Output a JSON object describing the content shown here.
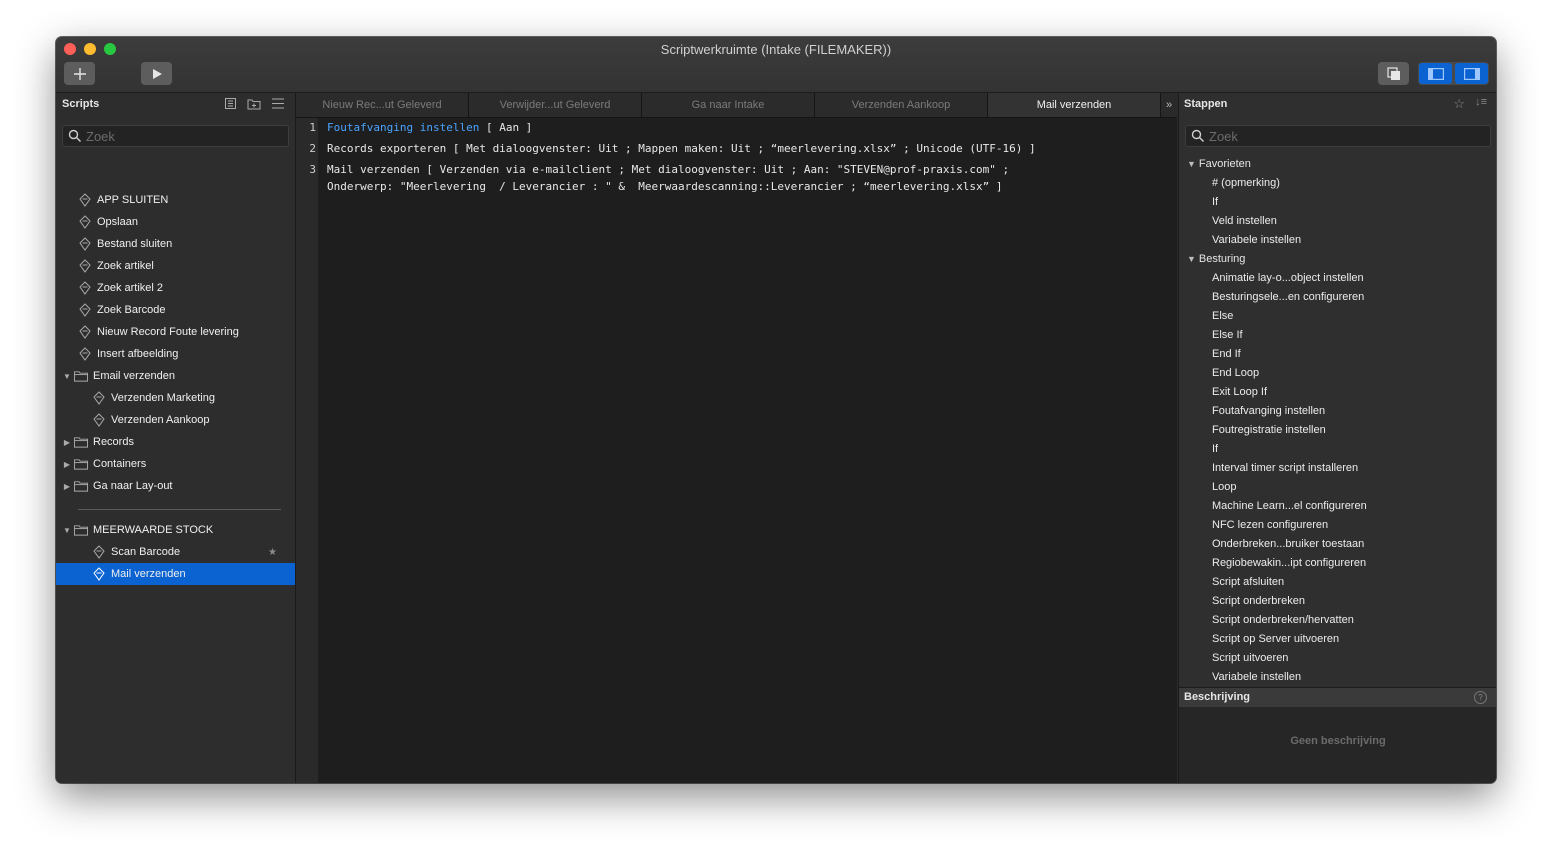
{
  "window": {
    "title": "Scriptwerkruimte (Intake (FILEMAKER))"
  },
  "scripts_panel": {
    "header": "Scripts",
    "search_placeholder": "Zoek",
    "items": [
      {
        "label": "APP SLUITEN",
        "kind": "script"
      },
      {
        "label": "Opslaan",
        "kind": "script"
      },
      {
        "label": "Bestand sluiten",
        "kind": "script"
      },
      {
        "label": "Zoek artikel",
        "kind": "script"
      },
      {
        "label": "Zoek artikel 2",
        "kind": "script"
      },
      {
        "label": "Zoek Barcode",
        "kind": "script"
      },
      {
        "label": "Nieuw Record Foute levering",
        "kind": "script"
      },
      {
        "label": "Insert afbeelding",
        "kind": "script"
      },
      {
        "label": "Email verzenden",
        "kind": "folder",
        "expanded": true
      },
      {
        "label": "Verzenden Marketing",
        "kind": "script",
        "indent": 1
      },
      {
        "label": "Verzenden Aankoop",
        "kind": "script",
        "indent": 1
      },
      {
        "label": "Records",
        "kind": "folder",
        "expanded": false
      },
      {
        "label": "Containers",
        "kind": "folder",
        "expanded": false
      },
      {
        "label": "Ga naar Lay-out",
        "kind": "folder",
        "expanded": false
      },
      {
        "label": "MEERWAARDE STOCK",
        "kind": "folder",
        "expanded": true
      },
      {
        "label": "Scan Barcode",
        "kind": "script",
        "indent": 1,
        "favorite": true
      },
      {
        "label": "Mail verzenden",
        "kind": "script",
        "indent": 1,
        "selected": true
      }
    ]
  },
  "editor": {
    "tabs": [
      {
        "label": "Nieuw Rec...ut Geleverd",
        "active": false
      },
      {
        "label": "Verwijder...ut Geleverd",
        "active": false
      },
      {
        "label": "Ga naar Intake",
        "active": false
      },
      {
        "label": "Verzenden Aankoop",
        "active": false
      },
      {
        "label": "Mail verzenden",
        "active": true
      }
    ],
    "more_tabs": "»",
    "lines": [
      {
        "num": "1",
        "keyword": "Foutafvanging instellen",
        "rest": " [ Aan ]"
      },
      {
        "num": "2",
        "keyword": "",
        "rest": "Records exporteren [ Met dialoogvenster: Uit ; Mappen maken: Uit ; “meerlevering.xlsx” ; Unicode (UTF-16) ]"
      },
      {
        "num": "3",
        "keyword": "",
        "rest": "Mail verzenden [ Verzenden via e-mailclient ; Met dialoogvenster: Uit ; Aan: \"STEVEN@prof-praxis.com\" ;"
      },
      {
        "num": "",
        "keyword": "",
        "rest": "Onderwerp: \"Meerlevering  / Leverancier : \" &  Meerwaardescanning::Leverancier ; “meerlevering.xlsx” ]"
      }
    ]
  },
  "steps_panel": {
    "header": "Stappen",
    "search_placeholder": "Zoek",
    "categories": [
      {
        "label": "Favorieten",
        "items": [
          "# (opmerking)",
          "If",
          "Veld instellen",
          "Variabele instellen"
        ]
      },
      {
        "label": "Besturing",
        "items": [
          "Animatie lay-o...object instellen",
          "Besturingsele...en configureren",
          "Else",
          "Else If",
          "End If",
          "End Loop",
          "Exit Loop If",
          "Foutafvanging instellen",
          "Foutregistratie instellen",
          "If",
          "Interval timer script installeren",
          "Loop",
          "Machine Learn...el configureren",
          "NFC lezen configureren",
          "Onderbreken...bruiker toestaan",
          "Regiobewakin...ipt configureren",
          "Script afsluiten",
          "Script onderbreken",
          "Script onderbreken/hervatten",
          "Script op Server uitvoeren",
          "Script uitvoeren",
          "Variabele instellen"
        ]
      }
    ],
    "description_header": "Beschrijving",
    "description_empty": "Geen beschrijving"
  },
  "colors": {
    "accent": "#0a63d0",
    "keyword": "#4aa3ff"
  }
}
